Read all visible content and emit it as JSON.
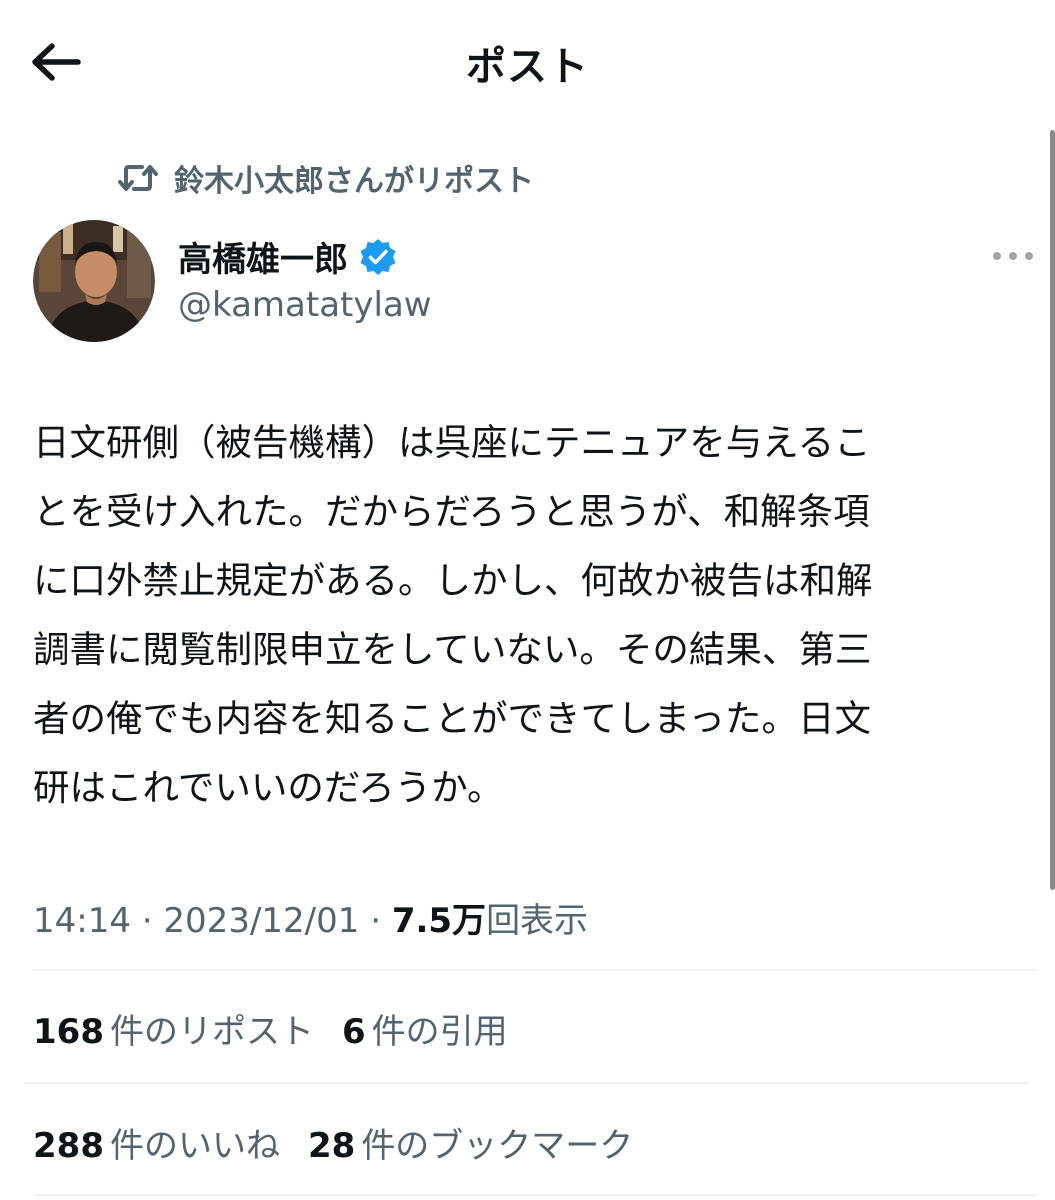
{
  "header": {
    "title": "ポスト"
  },
  "repost_context": {
    "text": "鈴木小太郎さんがリポスト"
  },
  "author": {
    "name": "高橋雄一郎",
    "handle": "@kamatatylaw",
    "verified": true
  },
  "tweet": {
    "text": "日文研側（被告機構）は呉座にテニュアを与えるこ\nとを受け入れた。だからだろうと思うが、和解条項\nに口外禁止規定がある。しかし、何故か被告は和解\n調書に閲覧制限申立をしていない。その結果、第三\n者の俺でも内容を知ることができてしまった。日文\n研はこれでいいのだろうか。"
  },
  "meta": {
    "time": "14:14",
    "separator": "·",
    "date": "2023/12/01",
    "views_count": "7.5万",
    "views_label": "回表示"
  },
  "stats": {
    "reposts_count": "168",
    "reposts_label": "件のリポスト",
    "quotes_count": "6",
    "quotes_label": "件の引用",
    "likes_count": "288",
    "likes_label": "件のいいね",
    "bookmarks_count": "28",
    "bookmarks_label": "件のブックマーク"
  },
  "colors": {
    "text_primary": "#0f1419",
    "text_secondary": "#536471",
    "verified_blue": "#1d9bf0",
    "divider": "#eff3f4"
  },
  "icons": {
    "back": "arrow-left-icon",
    "repost": "repost-icon",
    "verified": "verified-badge-icon",
    "more": "more-horizontal-icon"
  }
}
